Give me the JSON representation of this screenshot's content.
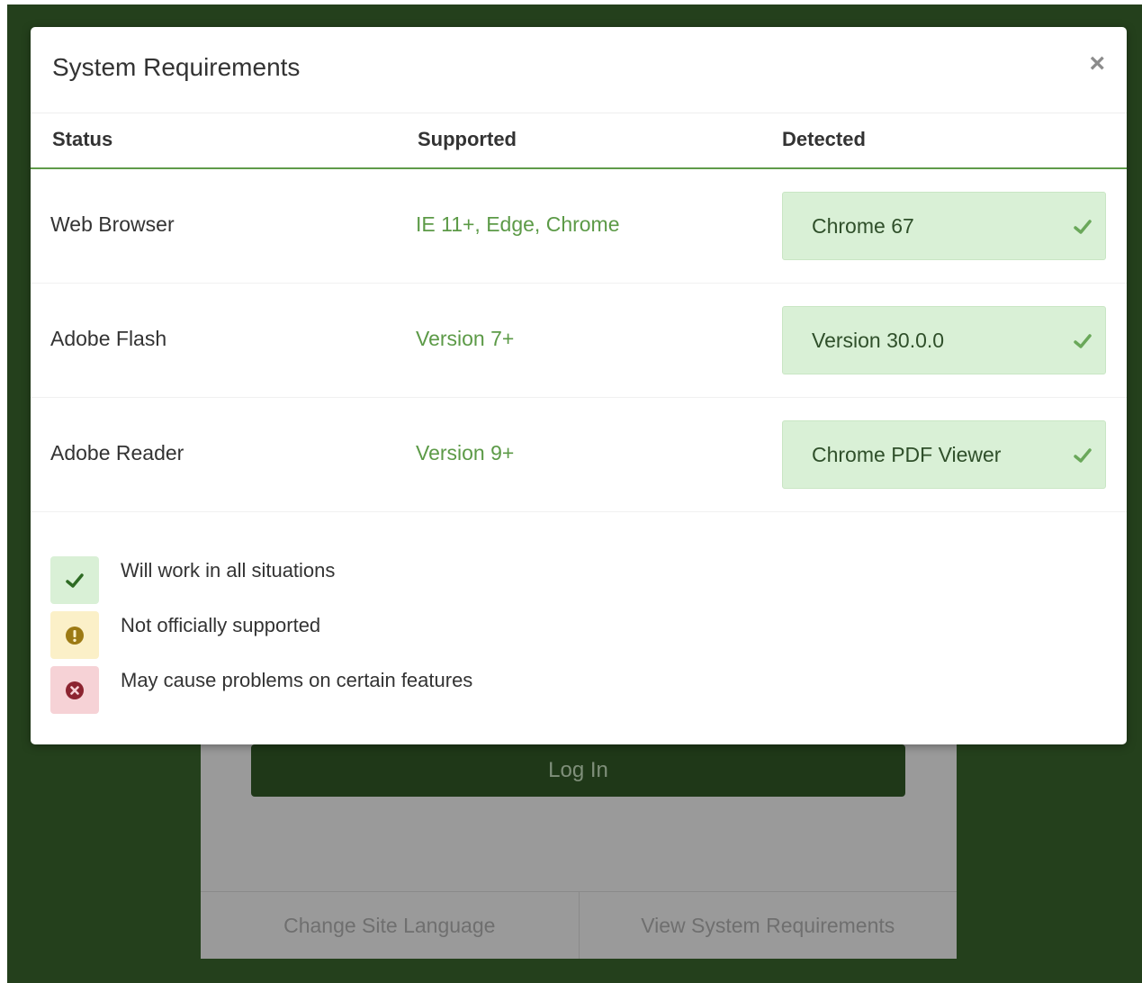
{
  "background": {
    "login_button": "Log In",
    "footer_links": [
      "Change Site Language",
      "View System Requirements"
    ]
  },
  "modal": {
    "title": "System Requirements",
    "close_symbol": "×",
    "headers": {
      "status": "Status",
      "supported": "Supported",
      "detected": "Detected"
    },
    "rows": [
      {
        "name": "Web Browser",
        "supported": "IE 11+, Edge, Chrome",
        "detected": "Chrome 67",
        "state": "ok"
      },
      {
        "name": "Adobe Flash",
        "supported": "Version 7+",
        "detected": "Version 30.0.0",
        "state": "ok"
      },
      {
        "name": "Adobe Reader",
        "supported": "Version 9+",
        "detected": "Chrome PDF Viewer",
        "state": "ok"
      }
    ],
    "legend": [
      {
        "icon": "check-icon",
        "text": "Will work in all situations"
      },
      {
        "icon": "exclamation-icon",
        "text": "Not officially supported"
      },
      {
        "icon": "x-circle-icon",
        "text": "May cause problems on certain features"
      }
    ]
  },
  "colors": {
    "backdrop": "#24401c",
    "success_bg": "#d9f0d6",
    "success_text": "#5c9a47",
    "warning_bg": "#fbf0c8",
    "danger_bg": "#f6d2d6"
  }
}
